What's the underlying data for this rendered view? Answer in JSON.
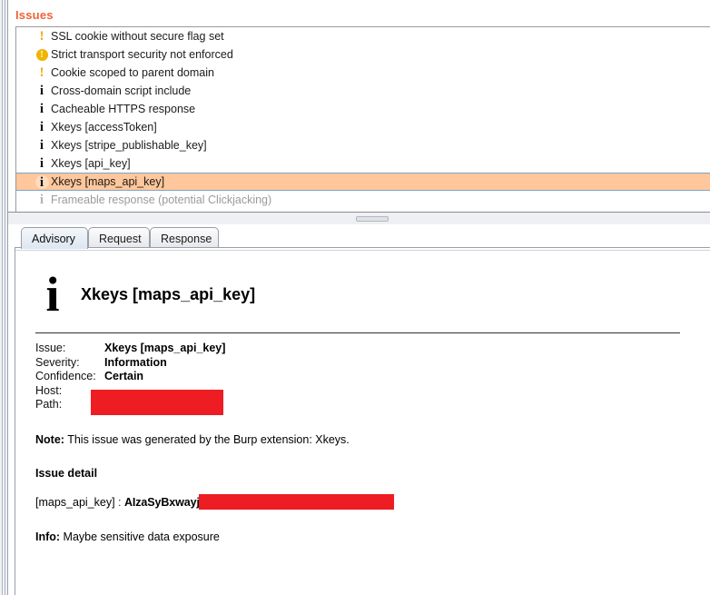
{
  "panel": {
    "issues_title": "Issues",
    "accent_color": "#ef6337",
    "selection_color": "#ffc79b",
    "redaction_color": "#ee1d23"
  },
  "issues": [
    {
      "icon": "warning-exclamation-icon",
      "label": "SSL cookie without secure flag set",
      "severity": "low",
      "selected": false,
      "muted": false
    },
    {
      "icon": "warning-circle-icon",
      "label": "Strict transport security not enforced",
      "severity": "low",
      "selected": false,
      "muted": false
    },
    {
      "icon": "warning-exclamation-icon",
      "label": "Cookie scoped to parent domain",
      "severity": "low",
      "selected": false,
      "muted": false
    },
    {
      "icon": "info-icon",
      "label": "Cross-domain script include",
      "severity": "information",
      "selected": false,
      "muted": false
    },
    {
      "icon": "info-icon",
      "label": "Cacheable HTTPS response",
      "severity": "information",
      "selected": false,
      "muted": false
    },
    {
      "icon": "info-icon",
      "label": "Xkeys [accessToken]",
      "severity": "information",
      "selected": false,
      "muted": false
    },
    {
      "icon": "info-icon",
      "label": "Xkeys [stripe_publishable_key]",
      "severity": "information",
      "selected": false,
      "muted": false
    },
    {
      "icon": "info-icon",
      "label": "Xkeys [api_key]",
      "severity": "information",
      "selected": false,
      "muted": false
    },
    {
      "icon": "info-icon",
      "label": "Xkeys [maps_api_key]",
      "severity": "information",
      "selected": true,
      "muted": false
    },
    {
      "icon": "info-icon",
      "label": "Frameable response (potential Clickjacking)",
      "severity": "information",
      "selected": false,
      "muted": true
    }
  ],
  "tabs": [
    {
      "label": "Advisory",
      "active": true
    },
    {
      "label": "Request",
      "active": false
    },
    {
      "label": "Response",
      "active": false
    }
  ],
  "advisory": {
    "icon": "info-icon",
    "title": "Xkeys [maps_api_key]",
    "meta": [
      {
        "key": "Issue:",
        "value": "Xkeys [maps_api_key]",
        "redacted": false
      },
      {
        "key": "Severity:",
        "value": "Information",
        "redacted": false
      },
      {
        "key": "Confidence:",
        "value": "Certain",
        "redacted": false
      },
      {
        "key": "Host:",
        "value": "",
        "redacted": true
      },
      {
        "key": "Path:",
        "value": "",
        "redacted": true
      }
    ],
    "note_label": "Note:",
    "note_text": " This issue was generated by the Burp extension: Xkeys.",
    "detail_heading": "Issue detail",
    "detail_key": "[maps_api_key]",
    "detail_separator": " : ",
    "detail_value": "AIzaSyBxwayj",
    "detail_value_redacted": true,
    "info_label": "Info:",
    "info_text": " Maybe sensitive data exposure"
  }
}
